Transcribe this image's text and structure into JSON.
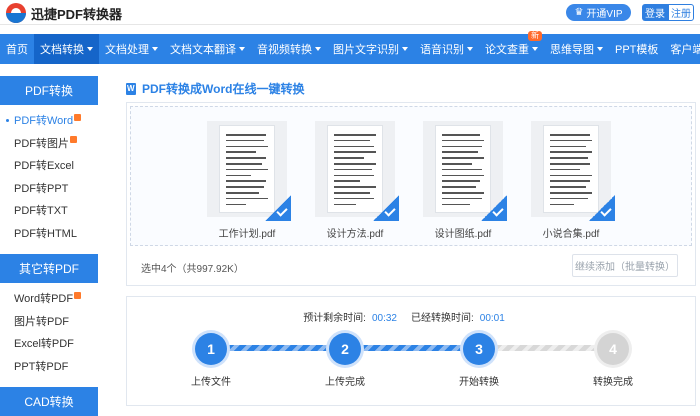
{
  "app": {
    "title": "迅捷PDF转换器",
    "vip_label": "开通VIP",
    "login_label": "登录",
    "register_label": "注册"
  },
  "nav": {
    "items": [
      {
        "label": "首页",
        "caret": false
      },
      {
        "label": "文档转换",
        "caret": true,
        "active": true
      },
      {
        "label": "文档处理",
        "caret": true
      },
      {
        "label": "文档文本翻译",
        "caret": true
      },
      {
        "label": "音视频转换",
        "caret": true
      },
      {
        "label": "图片文字识别",
        "caret": true
      },
      {
        "label": "语音识别",
        "caret": true
      },
      {
        "label": "论文查重",
        "caret": true,
        "badge": "新"
      },
      {
        "label": "思维导图",
        "caret": true
      },
      {
        "label": "PPT模板",
        "caret": false
      },
      {
        "label": "客户端",
        "caret": true
      }
    ]
  },
  "sidebar": {
    "groups": [
      {
        "title": "PDF转换",
        "items": [
          {
            "label": "PDF转Word",
            "active": true,
            "hot": true
          },
          {
            "label": "PDF转图片",
            "hot": true
          },
          {
            "label": "PDF转Excel"
          },
          {
            "label": "PDF转PPT"
          },
          {
            "label": "PDF转TXT"
          },
          {
            "label": "PDF转HTML"
          }
        ]
      },
      {
        "title": "其它转PDF",
        "items": [
          {
            "label": "Word转PDF",
            "hot": true
          },
          {
            "label": "图片转PDF"
          },
          {
            "label": "Excel转PDF"
          },
          {
            "label": "PPT转PDF"
          }
        ]
      },
      {
        "title": "CAD转换",
        "items": []
      }
    ]
  },
  "main": {
    "title": "PDF转换成Word在线一键转换",
    "files": [
      {
        "name": "工作计划.pdf",
        "checked": true
      },
      {
        "name": "设计方法.pdf",
        "checked": true
      },
      {
        "name": "设计图纸.pdf",
        "checked": true
      },
      {
        "name": "小说合集.pdf",
        "checked": true
      }
    ],
    "selected_summary": "选中4个（共997.92K）",
    "add_button_label": "继续添加（批量转换）"
  },
  "progress": {
    "remaining_label": "预计剩余时间:",
    "remaining_value": "00:32",
    "elapsed_label": "已经转换时间:",
    "elapsed_value": "00:01",
    "steps": [
      {
        "number": "1",
        "label": "上传文件",
        "done": true
      },
      {
        "number": "2",
        "label": "上传完成",
        "done": true
      },
      {
        "number": "3",
        "label": "开始转换",
        "done": true
      },
      {
        "number": "4",
        "label": "转换完成",
        "done": false
      }
    ]
  },
  "colors": {
    "primary": "#2c82e5",
    "nav_active": "#1565c9",
    "hot_badge": "#ff7a2b",
    "pending": "#d4d4d4"
  }
}
